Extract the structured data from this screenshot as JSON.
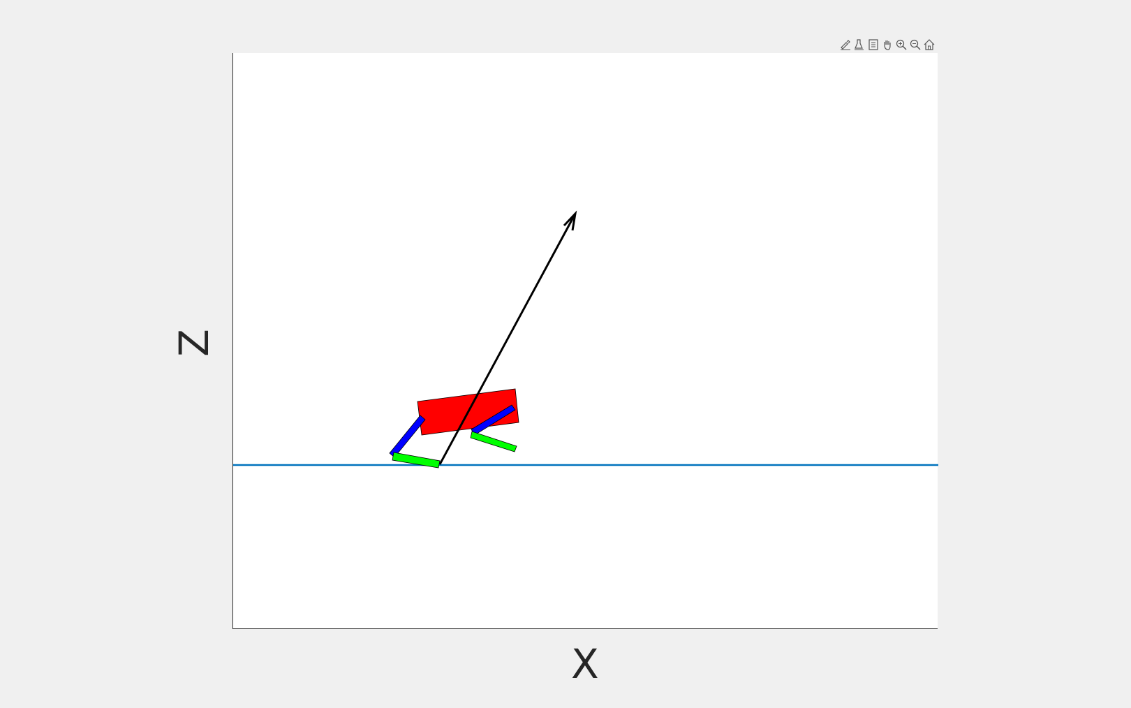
{
  "figure": {
    "xlabel": "X",
    "ylabel": "Z",
    "colors": {
      "background": "#f0f0f0",
      "axes_background": "#ffffff",
      "ground_line": "#0072bd",
      "body": "#ff0000",
      "upper_leg": "#0000ff",
      "lower_leg": "#00ff00",
      "arrow": "#000000"
    }
  },
  "toolbar": {
    "icons": [
      "brush-icon",
      "data-tips-icon",
      "legend-icon",
      "pan-icon",
      "zoom-in-icon",
      "zoom-out-icon",
      "home-icon"
    ]
  }
}
